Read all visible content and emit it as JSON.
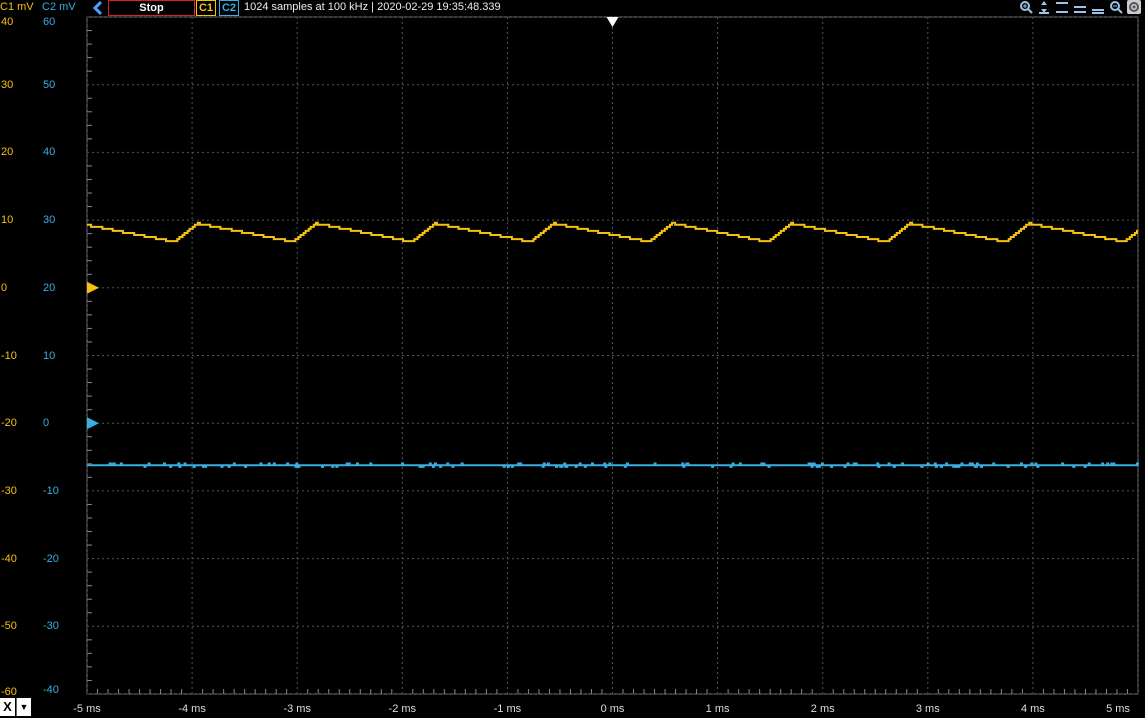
{
  "toolbar": {
    "c1_unit": "C1 mV",
    "c2_unit": "C2 mV",
    "back_icon": "chevron-left-icon",
    "stop_label": "Stop",
    "ch1_label": "C1",
    "ch2_label": "C2",
    "info": "1024 samples at 100 kHz | 2020-02-29 19:35:48.339",
    "tools": [
      "zoom-in-icon",
      "expand-vertical-icon",
      "align-top-icon",
      "align-center-icon",
      "align-bottom-icon",
      "zoom-out-icon",
      "settings-icon"
    ]
  },
  "axis": {
    "c1_ticks": [
      "40",
      "30",
      "20",
      "10",
      "0",
      "-10",
      "-20",
      "-30",
      "-40",
      "-50",
      "-60"
    ],
    "c2_ticks": [
      "60",
      "50",
      "40",
      "30",
      "20",
      "10",
      "0",
      "-10",
      "-20",
      "-30",
      "-40"
    ],
    "x_ticks": [
      "-5 ms",
      "-4 ms",
      "-3 ms",
      "-2 ms",
      "-1 ms",
      "0 ms",
      "1 ms",
      "2 ms",
      "3 ms",
      "4 ms",
      "5 ms"
    ],
    "x_button": "X",
    "x_dropdown": "▼"
  },
  "colors": {
    "c1": "#f5c211",
    "c2": "#3aaee0",
    "grid": "#555555",
    "stop_border": "#e02020"
  },
  "chart_data": {
    "type": "line",
    "x_unit": "ms",
    "xlim": [
      -5,
      5
    ],
    "c1": {
      "ylim": [
        -60,
        40
      ],
      "offset_marker": 0,
      "period_ms": 1.13,
      "first_peak_ms": -3.95,
      "peak_mv": 9.5,
      "trough_mv": 6.8
    },
    "c2": {
      "ylim": [
        -40,
        60
      ],
      "offset_marker": 0,
      "level_mv": -6.2
    },
    "trigger_time_ms": 0
  }
}
